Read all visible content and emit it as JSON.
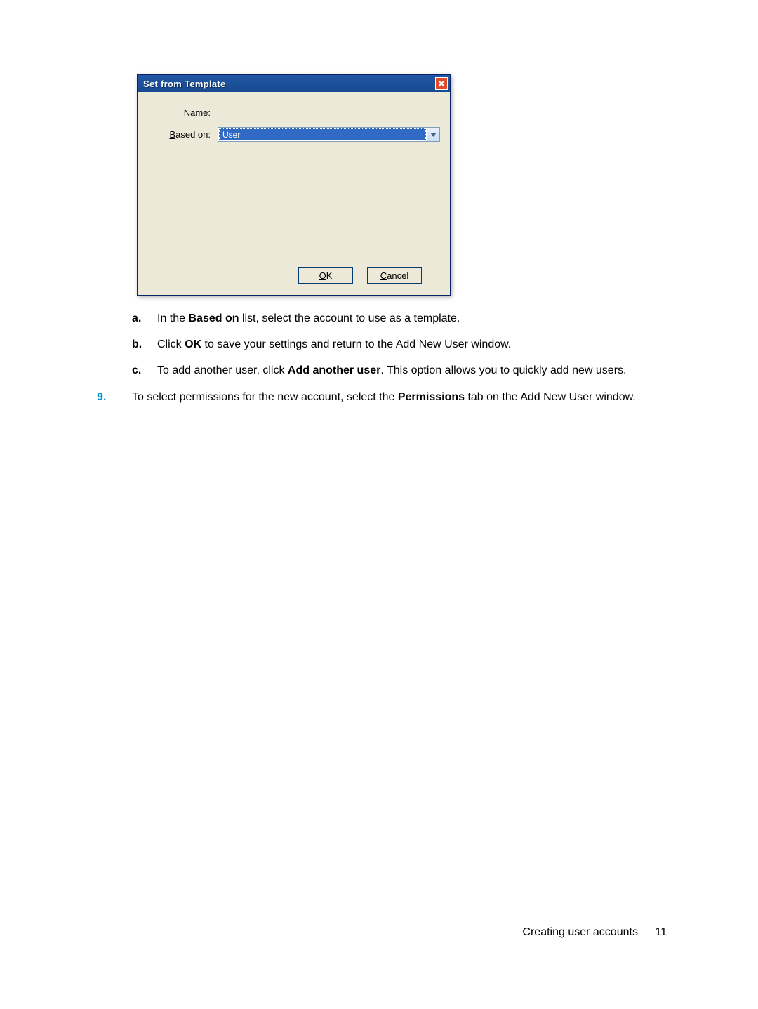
{
  "dialog": {
    "title": "Set from Template",
    "name_label": "Name:",
    "based_on_label": "Based on:",
    "based_on_value": "User",
    "ok_label": "OK",
    "ok_mnemonic": "O",
    "ok_rest": "K",
    "cancel_label": "Cancel",
    "cancel_mnemonic": "C",
    "cancel_rest": "ancel"
  },
  "steps": {
    "a": {
      "marker": "a.",
      "prefix": "In the ",
      "bold": "Based on",
      "suffix": " list, select the account to use as a template."
    },
    "b": {
      "marker": "b.",
      "prefix": "Click ",
      "bold": "OK",
      "suffix": " to save your settings and return to the Add New User window."
    },
    "c": {
      "marker": "c.",
      "prefix": "To add another user, click ",
      "bold": "Add another user",
      "suffix": ". This option allows you to quickly add new users."
    },
    "nine": {
      "marker": "9.",
      "prefix": "To select permissions for the new account, select the ",
      "bold": "Permissions",
      "suffix": " tab on the Add New User window."
    }
  },
  "footer": {
    "section": "Creating user accounts",
    "page_number": "11"
  }
}
